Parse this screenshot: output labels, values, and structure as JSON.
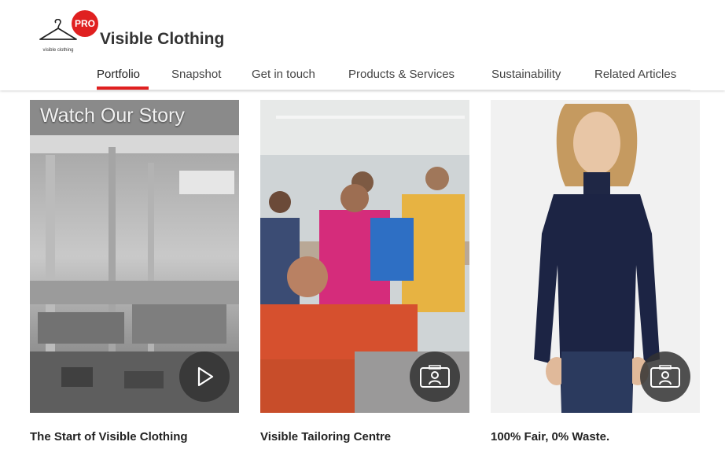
{
  "header": {
    "logo_text": "visible clothing",
    "badge": "PRO",
    "brand_name": "Visible Clothing"
  },
  "nav": {
    "items": [
      {
        "label": "Portfolio",
        "active": true
      },
      {
        "label": "Snapshot"
      },
      {
        "label": "Get in touch"
      },
      {
        "label": "Products & Services"
      },
      {
        "label": "Sustainability"
      },
      {
        "label": "Related Articles"
      }
    ]
  },
  "cards": [
    {
      "title": "The Start of Visible Clothing",
      "overlay_text": "Watch Our Story",
      "icon": "play-icon"
    },
    {
      "title": "Visible Tailoring Centre",
      "icon": "profile-card-icon"
    },
    {
      "title": "100% Fair, 0% Waste.",
      "icon": "profile-card-icon"
    }
  ],
  "colors": {
    "accent": "#e02020",
    "button_overlay": "#323232"
  }
}
